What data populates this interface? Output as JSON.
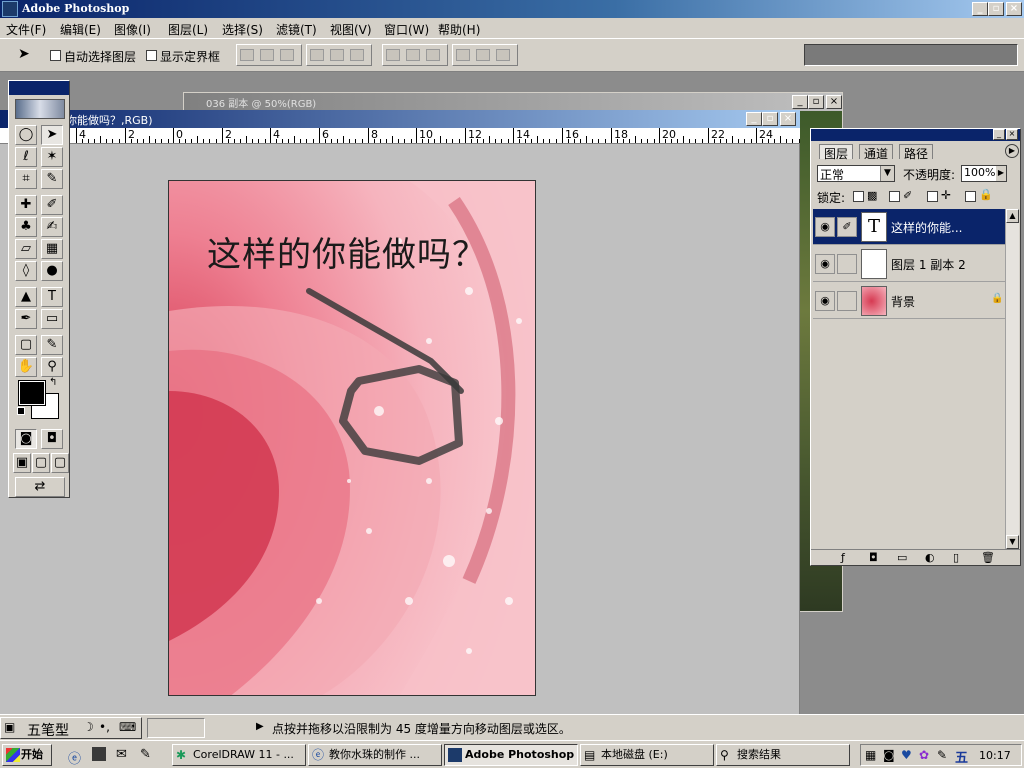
{
  "app": {
    "title": "Adobe Photoshop"
  },
  "window_controls": {
    "minimize": "_",
    "maximize": "▫",
    "close": "×"
  },
  "menu": [
    "文件(F)",
    "编辑(E)",
    "图像(I)",
    "图层(L)",
    "选择(S)",
    "滤镜(T)",
    "视图(V)",
    "窗口(W)",
    "帮助(H)"
  ],
  "options": {
    "auto_select_label": "自动选择图层",
    "show_bounds_label": "显示定界框"
  },
  "back_document": {
    "title": "036 副本 @ 50%(RGB)"
  },
  "document": {
    "title": "你能做吗？,RGB)",
    "headline": "这样的你能做吗？"
  },
  "ruler": {
    "labels": [
      "4",
      "2",
      "0",
      "2",
      "4",
      "6",
      "8",
      "10",
      "12",
      "14",
      "16",
      "18",
      "20",
      "22",
      "24"
    ]
  },
  "layers_panel": {
    "tabs": [
      "图层",
      "通道",
      "路径"
    ],
    "blend_mode": "正常",
    "opacity_label": "不透明度:",
    "opacity_value": "100%",
    "lock_label": "锁定:",
    "layers": [
      {
        "name": "这样的你能...",
        "thumb": "T",
        "selected": true
      },
      {
        "name": "图层 1 副本 2",
        "thumb": "",
        "selected": false
      },
      {
        "name": "背景",
        "thumb": "",
        "selected": false
      }
    ]
  },
  "status": {
    "ime": "五笔型",
    "hint": "点按并拖移以沿限制为 45 度增量方向移动图层或选区。"
  },
  "taskbar": {
    "start": "开始",
    "tasks": [
      "CorelDRAW 11 - ...",
      "教你水珠的制作 ...",
      "Adobe Photoshop",
      "本地磁盘 (E:)",
      "搜索结果"
    ],
    "clock": "10:17",
    "tray_ime": "五"
  },
  "colors": {
    "title_active": "#0a246a",
    "chrome": "#d4d0c8",
    "selection": "#0a246a"
  }
}
